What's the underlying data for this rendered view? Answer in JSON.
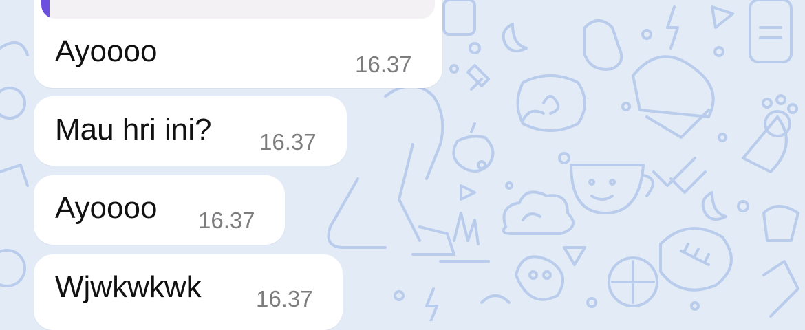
{
  "colors": {
    "background": "#e3ebf6",
    "doodle_stroke": "#b9ccec",
    "bubble": "#ffffff",
    "reply_accent": "#6a4fe0",
    "text": "#111111",
    "time": "#7d7d80"
  },
  "messages": [
    {
      "text": "Ayoooo",
      "time": "16.37",
      "has_reply_preview": true
    },
    {
      "text": "Mau hri ini?",
      "time": "16.37"
    },
    {
      "text": "Ayoooo",
      "time": "16.37"
    },
    {
      "text": "Wjwkwkwk",
      "time": "16.37"
    }
  ]
}
